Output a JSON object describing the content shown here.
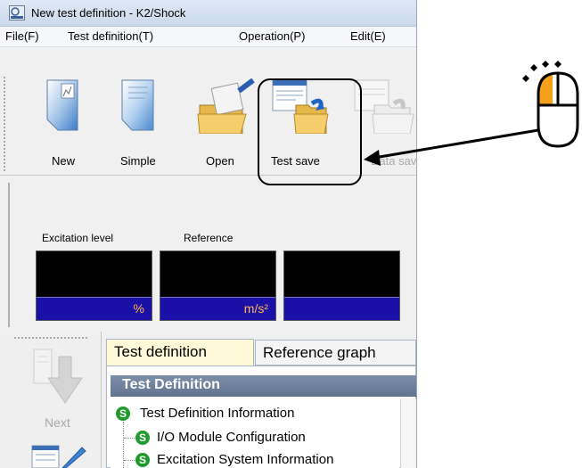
{
  "window": {
    "title": "New test definition - K2/Shock"
  },
  "menu": [
    {
      "label": "File(F)"
    },
    {
      "label": "Test definition(T)"
    },
    {
      "label": "Operation(P)"
    },
    {
      "label": "Edit(E)"
    }
  ],
  "toolbar": {
    "buttons": [
      {
        "label": "New",
        "icon": "new-document-icon",
        "enabled": true
      },
      {
        "label": "Simple",
        "icon": "simple-document-icon",
        "enabled": true
      },
      {
        "label": "Open",
        "icon": "open-folder-icon",
        "enabled": true
      },
      {
        "label": "Test save",
        "icon": "test-save-icon",
        "enabled": true,
        "highlighted": true
      },
      {
        "label": "Data save",
        "icon": "data-save-icon",
        "enabled": false
      }
    ]
  },
  "meters": {
    "labels": [
      "Excitation level",
      "Reference"
    ],
    "units": [
      "%",
      "m/s²",
      ""
    ]
  },
  "left_pane": {
    "next_label": "Next",
    "next_enabled": false
  },
  "tabs": [
    {
      "label": "Test definition",
      "active": true
    },
    {
      "label": "Reference graph",
      "active": false
    }
  ],
  "panel": {
    "title": "Test Definition",
    "tree": [
      {
        "label": "Test Definition Information",
        "level": 0,
        "icon": "S"
      },
      {
        "label": "I/O Module Configuration",
        "level": 1,
        "icon": "S"
      },
      {
        "label": "Excitation System Information",
        "level": 1,
        "icon": "S"
      }
    ]
  },
  "annotation": {
    "icon": "mouse-left-click-icon",
    "accent_color": "#f5a11a"
  }
}
